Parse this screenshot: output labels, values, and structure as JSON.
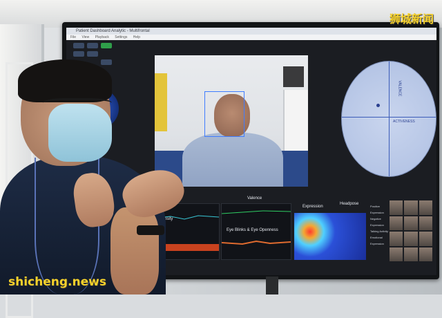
{
  "watermarks": {
    "top_right": "狮城新闻",
    "bottom_left": "shicheng.news"
  },
  "app": {
    "window_title": "Patient Dashboard Analytic - Multifrontal",
    "menu": [
      "File",
      "View",
      "Playback",
      "Settings",
      "Help"
    ],
    "side_label": "",
    "radar_labels": {
      "horizontal": "ACTIVENESS",
      "vertical": "VALENCE"
    }
  },
  "panels": {
    "valence": "Valence",
    "intensity": "Intensity",
    "eye_blinks": "Eye Blinks & Eye Openness",
    "expression": "Expression",
    "headpose": "Headpose",
    "side_list": [
      "Positive Expression",
      "Negative Expression",
      "Talking Activity",
      "Emotional Expression"
    ]
  },
  "colors": {
    "accent": "#3f7cff",
    "heat_hot": "#ff3b2f",
    "watermark": "#f7d22b"
  }
}
